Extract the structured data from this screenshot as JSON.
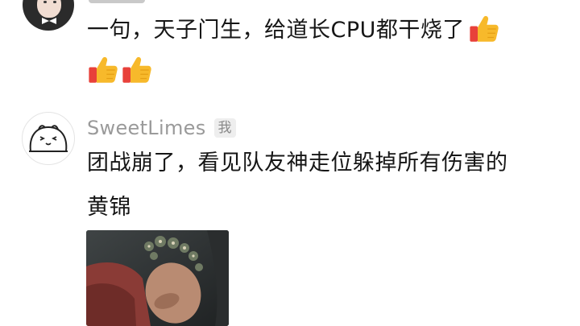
{
  "comments": [
    {
      "text": "一句，天子门生，给道长CPU都干烧了",
      "reactions": [
        "thumbs-up-icon",
        "thumbs-up-icon",
        "thumbs-up-icon"
      ]
    },
    {
      "username": "SweetLimes",
      "badge": "我",
      "text_line1": "团战崩了，看见队友神走位躲掉所有伤害的",
      "text_line2": "黄锦",
      "attachment": "image-thumbnail"
    }
  ],
  "colors": {
    "text_primary": "#161616",
    "username": "#9a9a9a",
    "badge_bg": "#eeeeee",
    "emoji_yellow": "#f7b92b",
    "emoji_red": "#e8413a"
  }
}
